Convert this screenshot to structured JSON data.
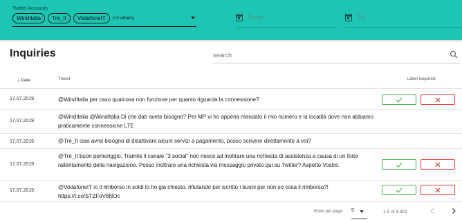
{
  "filters": {
    "accounts_label": "Twitter Accounts",
    "chips": [
      "WindItalia",
      "Tre_It",
      "VodafoneIT"
    ],
    "more_text": "(+2 others)",
    "from_label": "From:",
    "to_label": "To:"
  },
  "page": {
    "title": "Inquiries",
    "search_placeholder": "search"
  },
  "table": {
    "columns": {
      "date": "Date",
      "tweet": "Tweet",
      "label": "Label required"
    },
    "sort_icon": "arrow-down",
    "rows": [
      {
        "date": "17.07.2019",
        "tweet": "@WindItalia per caso qualcosa non funzione per quanto riguarda la connessione?",
        "label_required": true
      },
      {
        "date": "17.07.2019",
        "tweet": "@WindItalia @WindItalia Di che dati avete bisogno? Per MP vi ho appena mandato il mio numero e la località dove non abbiamo praticamente connessione LTE",
        "label_required": false
      },
      {
        "date": "17.07.2019",
        "tweet": "@Tre_It ciao avrei bisogno di disattivare alcuni servizi a pagamento, posso scrivere direttamente a voi?",
        "label_required": false
      },
      {
        "date": "17.07.2019",
        "tweet": "@Tre_It buon pomeriggio. Tramite il canale \"3 social\" non riesco ad inoltrare una richiesta di assistenza a causa di un forte rallentamento della navigazione. Posso inoltrare una richiesta via messaggio privato qui su Twitter? Aspetto Vostre.",
        "label_required": true
      },
      {
        "date": "17.07.2019",
        "tweet": "@VodafoneIT io il rimborso in soldi lo ho già chiesto, rifiutando per iscritto i buoni per non so cosa il rimborso?! https://t.co/STZFoV6NOc",
        "label_required": true
      }
    ]
  },
  "pagination": {
    "rows_per_page_label": "Rows per page:",
    "rows_per_page_value": "5",
    "range_text": "1-5 of 4,402"
  },
  "colors": {
    "header_bg": "#1ec4b4",
    "approve": "#4caf50",
    "reject": "#e53935"
  }
}
